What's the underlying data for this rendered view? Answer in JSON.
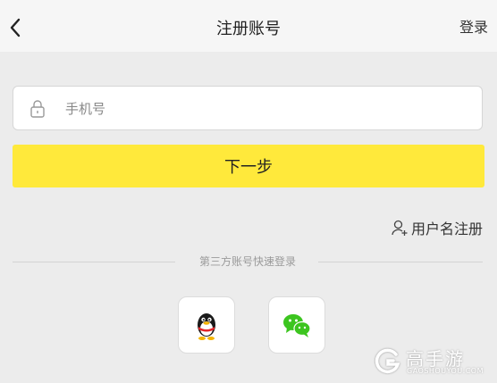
{
  "nav": {
    "title": "注册账号",
    "login_label": "登录",
    "back_icon": "chevron-left-icon"
  },
  "form": {
    "phone_placeholder": "手机号",
    "phone_value": "",
    "lock_icon": "lock-icon",
    "next_label": "下一步"
  },
  "alt_register": {
    "label": "用户名注册",
    "icon": "user-add-icon"
  },
  "third_party": {
    "heading": "第三方账号快速登录",
    "providers": [
      {
        "name": "QQ",
        "icon": "qq-penguin-icon"
      },
      {
        "name": "WeChat",
        "icon": "wechat-icon"
      }
    ]
  },
  "watermark": {
    "brand": "高手游",
    "sub": "GAOSHOUYOU.COM"
  },
  "colors": {
    "accent_yellow": "#ffe93b",
    "wechat_green": "#3cc51f",
    "background": "#ececec"
  }
}
